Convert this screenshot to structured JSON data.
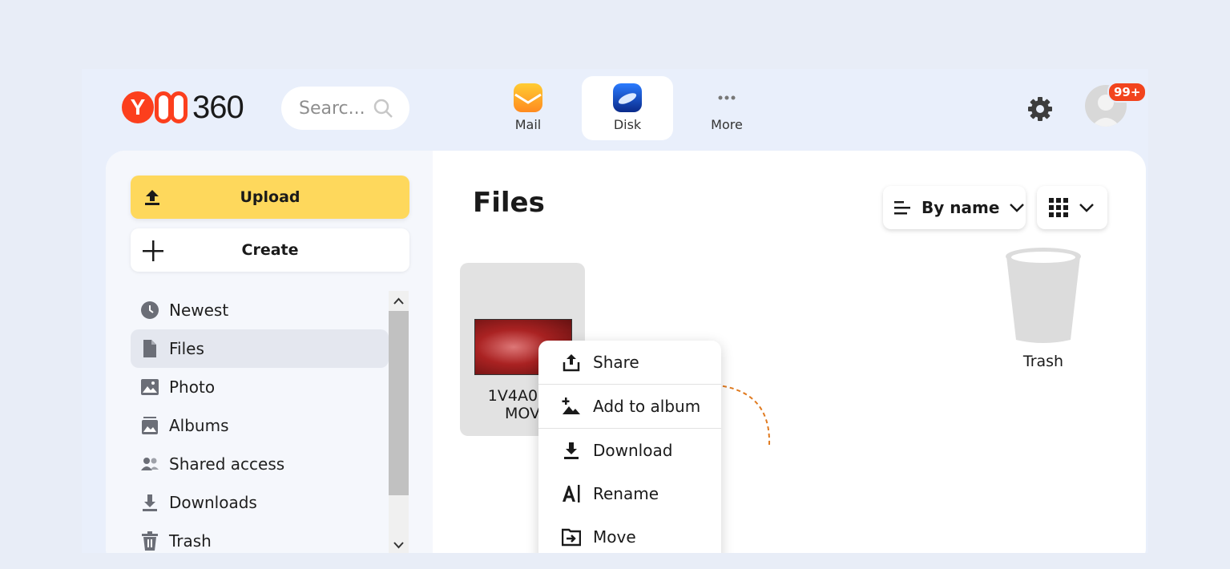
{
  "header": {
    "logo_text": "360",
    "search_placeholder": "Searc...",
    "apps": [
      {
        "label": "Mail",
        "icon": "mail-icon"
      },
      {
        "label": "Disk",
        "icon": "disk-icon",
        "active": true
      },
      {
        "label": "More",
        "icon": "more-icon"
      }
    ],
    "notification_badge": "99+",
    "accent_color": "#fc3f1d"
  },
  "sidebar": {
    "upload_label": "Upload",
    "create_label": "Create",
    "items": [
      {
        "label": "Newest",
        "icon": "clock-icon"
      },
      {
        "label": "Files",
        "icon": "file-icon",
        "active": true
      },
      {
        "label": "Photo",
        "icon": "photo-icon"
      },
      {
        "label": "Albums",
        "icon": "albums-icon"
      },
      {
        "label": "Shared access",
        "icon": "users-icon"
      },
      {
        "label": "Downloads",
        "icon": "download-icon"
      },
      {
        "label": "Trash",
        "icon": "trash-icon"
      }
    ],
    "upload_color": "#fed85c"
  },
  "main": {
    "title": "Files",
    "sort_label": "By name",
    "files": [
      {
        "name_line1": "1V4A000",
        "name_line2": "MOV"
      }
    ],
    "trash_label": "Trash"
  },
  "context_menu": {
    "items": [
      {
        "label": "Share",
        "icon": "share-icon"
      },
      {
        "label": "Add to album",
        "icon": "add-to-album-icon"
      },
      {
        "label": "Download",
        "icon": "download-icon"
      },
      {
        "label": "Rename",
        "icon": "rename-icon"
      },
      {
        "label": "Move",
        "icon": "move-icon"
      }
    ]
  }
}
